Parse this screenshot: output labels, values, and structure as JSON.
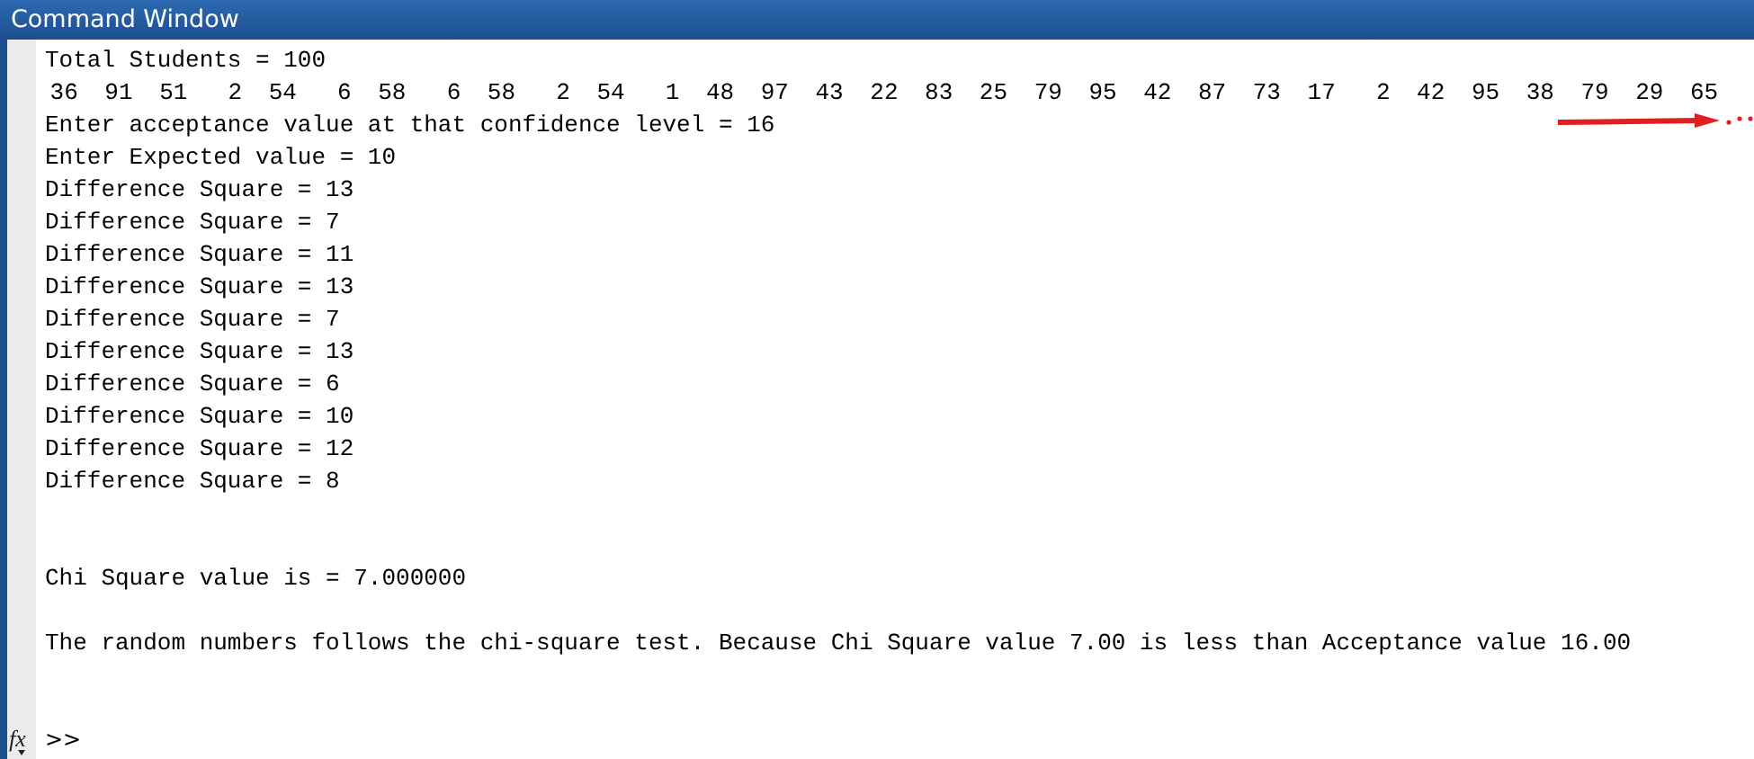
{
  "window": {
    "title": "Command Window"
  },
  "lines": [
    {
      "kind": "text",
      "text": "Total Students = 100"
    },
    {
      "kind": "numbers",
      "values": [
        "36",
        "91",
        "51",
        "2",
        "54",
        "6",
        "58",
        "6",
        "58",
        "2",
        "54",
        "1",
        "48",
        "97",
        "43",
        "22",
        "83",
        "25",
        "79",
        "95",
        "42",
        "87",
        "73",
        "17",
        "2",
        "42",
        "95",
        "38",
        "79",
        "29",
        "65"
      ]
    },
    {
      "kind": "text",
      "text": "Enter acceptance value at that confidence level = 16"
    },
    {
      "kind": "text",
      "text": "Enter Expected value = 10"
    },
    {
      "kind": "text",
      "text": "Difference Square = 13"
    },
    {
      "kind": "text",
      "text": "Difference Square = 7"
    },
    {
      "kind": "text",
      "text": "Difference Square = 11"
    },
    {
      "kind": "text",
      "text": "Difference Square = 13"
    },
    {
      "kind": "text",
      "text": "Difference Square = 7"
    },
    {
      "kind": "text",
      "text": "Difference Square = 13"
    },
    {
      "kind": "text",
      "text": "Difference Square = 6"
    },
    {
      "kind": "text",
      "text": "Difference Square = 10"
    },
    {
      "kind": "text",
      "text": "Difference Square = 12"
    },
    {
      "kind": "text",
      "text": "Difference Square = 8"
    },
    {
      "kind": "blank"
    },
    {
      "kind": "blank"
    },
    {
      "kind": "text",
      "text": "Chi Square value is = 7.000000"
    },
    {
      "kind": "blank"
    },
    {
      "kind": "text",
      "text": "The random numbers follows the chi-square test. Because Chi Square value 7.00 is less than Acceptance value 16.00"
    },
    {
      "kind": "blank"
    },
    {
      "kind": "blank"
    }
  ],
  "function_button": "fx",
  "prompt": ">>"
}
